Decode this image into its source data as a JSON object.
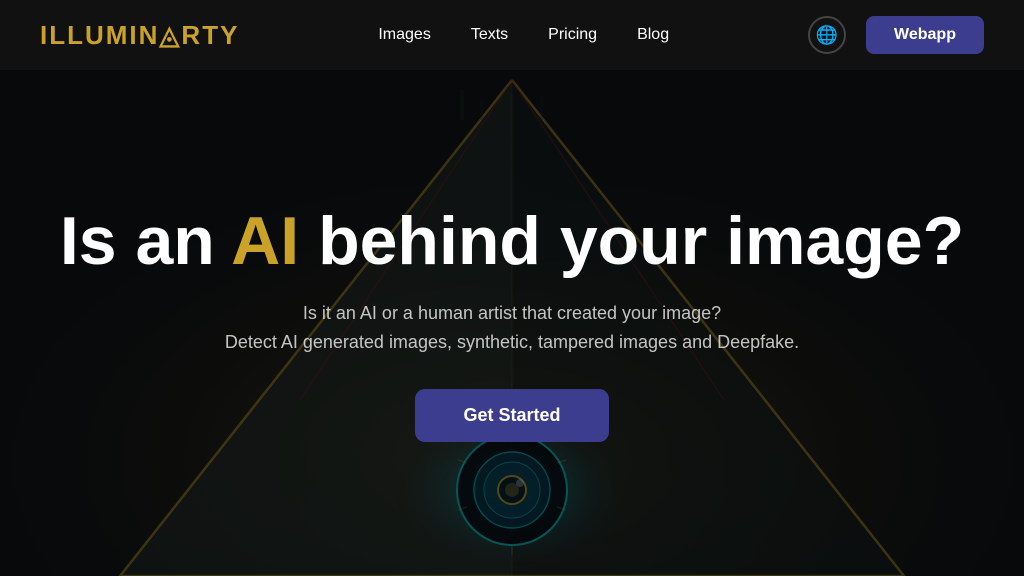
{
  "brand": {
    "logo_text_1": "ILLUMIN",
    "logo_symbol": "◬",
    "logo_text_2": "RTY"
  },
  "nav": {
    "links": [
      {
        "label": "Images",
        "id": "nav-images"
      },
      {
        "label": "Texts",
        "id": "nav-texts"
      },
      {
        "label": "Pricing",
        "id": "nav-pricing"
      },
      {
        "label": "Blog",
        "id": "nav-blog"
      }
    ],
    "globe_label": "🌐",
    "webapp_label": "Webapp"
  },
  "hero": {
    "title_part1": "Is an ",
    "title_ai": "AI",
    "title_part2": " behind your image?",
    "subtitle1": "Is it an AI or a human artist that created your image?",
    "subtitle2": "Detect AI generated images, synthetic, tampered images and Deepfake.",
    "cta_label": "Get Started"
  },
  "colors": {
    "gold": "#c9a227",
    "dark_navy": "#3d3d8f",
    "bg_dark": "#111111"
  }
}
